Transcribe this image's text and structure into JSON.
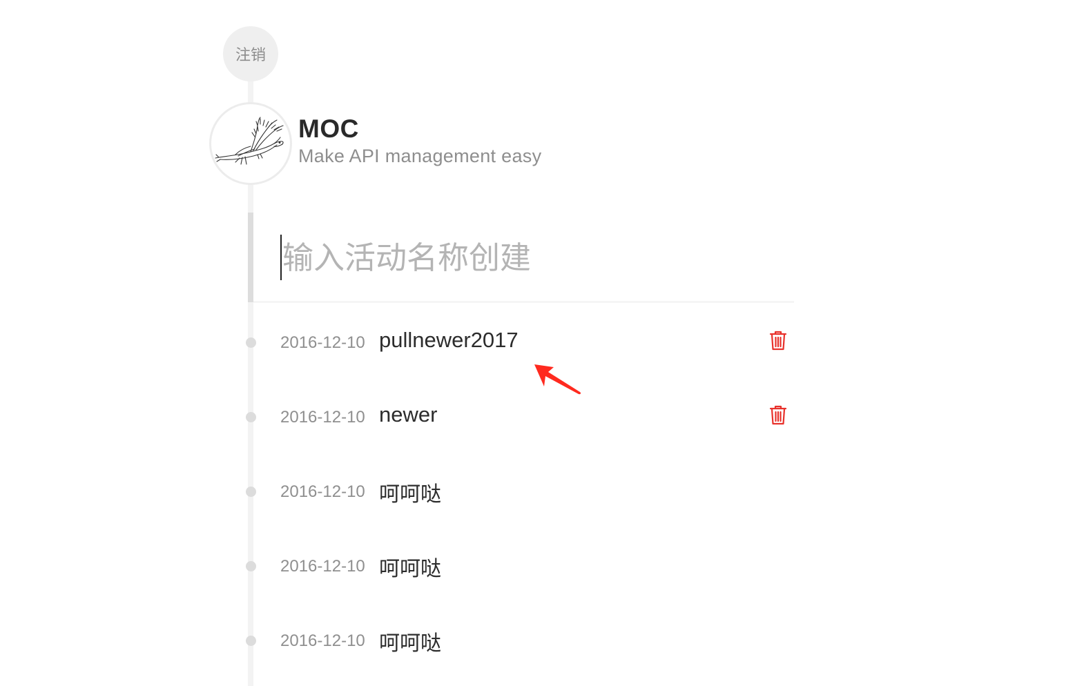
{
  "header": {
    "logout_label": "注销",
    "title": "MOC",
    "subtitle": "Make API management easy"
  },
  "create": {
    "placeholder": "输入活动名称创建"
  },
  "activities": [
    {
      "date": "2016-12-10",
      "name": "pullnewer2017",
      "deletable": true
    },
    {
      "date": "2016-12-10",
      "name": "newer",
      "deletable": true
    },
    {
      "date": "2016-12-10",
      "name": "呵呵哒",
      "deletable": false
    },
    {
      "date": "2016-12-10",
      "name": "呵呵哒",
      "deletable": false
    },
    {
      "date": "2016-12-10",
      "name": "呵呵哒",
      "deletable": false
    }
  ],
  "colors": {
    "delete": "#e8312b",
    "annotation_arrow": "#ff2a1f",
    "timeline": "#f3f3f3",
    "dot": "#dcdcdc"
  },
  "icons": {
    "delete": "trash-icon",
    "avatar": "bird-logo"
  }
}
